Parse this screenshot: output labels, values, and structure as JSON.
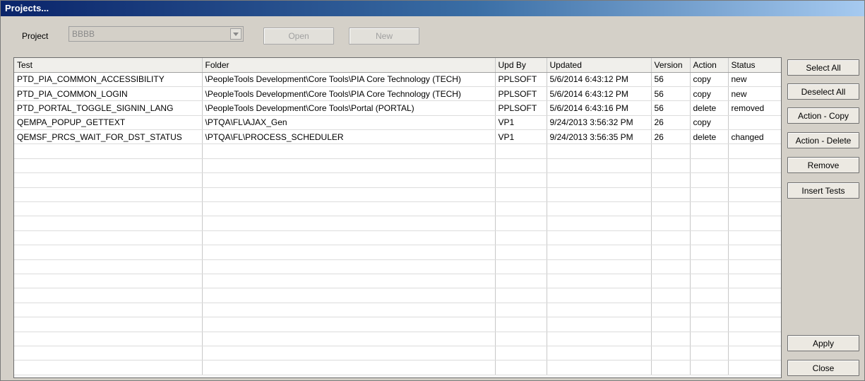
{
  "window": {
    "title": "Projects..."
  },
  "project": {
    "label": "Project",
    "value": "BBBB"
  },
  "toolbar": {
    "open_label": "Open",
    "new_label": "New"
  },
  "table": {
    "columns": [
      "Test",
      "Folder",
      "Upd By",
      "Updated",
      "Version",
      "Action",
      "Status"
    ],
    "rows": [
      [
        "PTD_PIA_COMMON_ACCESSIBILITY",
        "\\PeopleTools Development\\Core Tools\\PIA Core Technology (TECH)",
        "PPLSOFT",
        "5/6/2014 6:43:12 PM",
        "56",
        "copy",
        "new"
      ],
      [
        "PTD_PIA_COMMON_LOGIN",
        "\\PeopleTools Development\\Core Tools\\PIA Core Technology (TECH)",
        "PPLSOFT",
        "5/6/2014 6:43:12 PM",
        "56",
        "copy",
        "new"
      ],
      [
        "PTD_PORTAL_TOGGLE_SIGNIN_LANG",
        "\\PeopleTools Development\\Core Tools\\Portal (PORTAL)",
        "PPLSOFT",
        "5/6/2014 6:43:16 PM",
        "56",
        "delete",
        "removed"
      ],
      [
        "QEMPA_POPUP_GETTEXT",
        "\\PTQA\\FL\\AJAX_Gen",
        "VP1",
        "9/24/2013 3:56:32 PM",
        "26",
        "copy",
        ""
      ],
      [
        "QEMSF_PRCS_WAIT_FOR_DST_STATUS",
        "\\PTQA\\FL\\PROCESS_SCHEDULER",
        "VP1",
        "9/24/2013 3:56:35 PM",
        "26",
        "delete",
        "changed"
      ]
    ]
  },
  "sidebar": {
    "select_all": "Select All",
    "deselect_all": "Deselect All",
    "action_copy": "Action - Copy",
    "action_delete": "Action - Delete",
    "remove": "Remove",
    "insert_tests": "Insert Tests",
    "apply": "Apply",
    "close": "Close"
  }
}
